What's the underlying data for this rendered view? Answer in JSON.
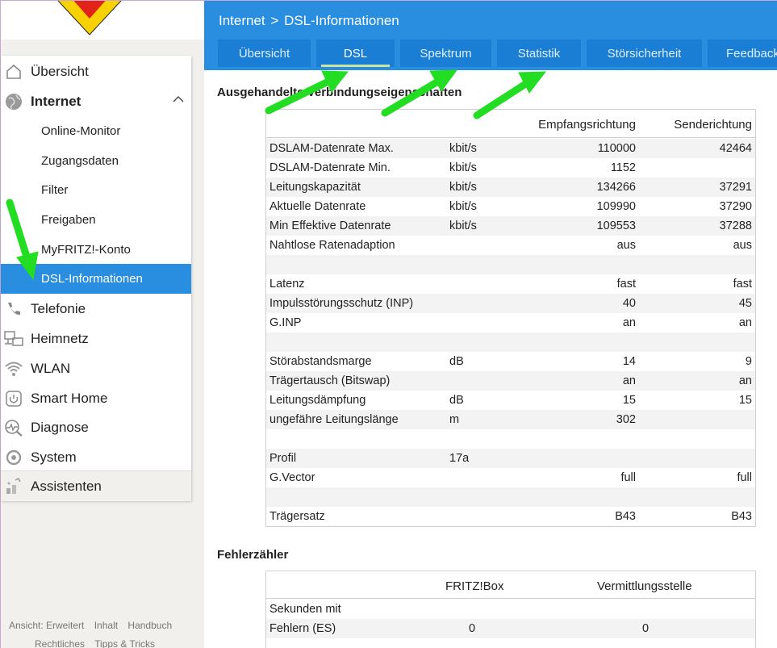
{
  "header": {
    "breadcrumb_root": "Internet",
    "breadcrumb_sep": ">",
    "breadcrumb_current": "DSL-Informationen",
    "tabs": [
      {
        "label": "Übersicht"
      },
      {
        "label": "DSL"
      },
      {
        "label": "Spektrum"
      },
      {
        "label": "Statistik"
      },
      {
        "label": "Störsicherheit"
      },
      {
        "label": "Feedback"
      }
    ]
  },
  "sidebar": {
    "items": [
      {
        "label": "Übersicht",
        "icon": "home-icon"
      },
      {
        "label": "Internet",
        "icon": "globe-icon"
      },
      {
        "label": "Online-Monitor"
      },
      {
        "label": "Zugangsdaten"
      },
      {
        "label": "Filter"
      },
      {
        "label": "Freigaben"
      },
      {
        "label": "MyFRITZ!-Konto"
      },
      {
        "label": "DSL-Informationen"
      },
      {
        "label": "Telefonie",
        "icon": "phone-icon"
      },
      {
        "label": "Heimnetz",
        "icon": "network-icon"
      },
      {
        "label": "WLAN",
        "icon": "wifi-icon"
      },
      {
        "label": "Smart Home",
        "icon": "smart-home-icon"
      },
      {
        "label": "Diagnose",
        "icon": "diagnose-icon"
      },
      {
        "label": "System",
        "icon": "system-icon"
      },
      {
        "label": "Assistenten",
        "icon": "wizard-icon"
      }
    ]
  },
  "footer": {
    "links": [
      "Ansicht: Erweitert",
      "Inhalt",
      "Handbuch",
      "Rechtliches",
      "Tipps & Tricks"
    ]
  },
  "section1": {
    "title": "Ausgehandelte Verbindungseigenschaften",
    "col_recv": "Empfangsrichtung",
    "col_send": "Senderichtung",
    "rows": [
      {
        "label": "DSLAM-Datenrate Max.",
        "unit": "kbit/s",
        "recv": "110000",
        "send": "42464"
      },
      {
        "label": "DSLAM-Datenrate Min.",
        "unit": "kbit/s",
        "recv": "1152",
        "send": ""
      },
      {
        "label": "Leitungskapazität",
        "unit": "kbit/s",
        "recv": "134266",
        "send": "37291"
      },
      {
        "label": "Aktuelle Datenrate",
        "unit": "kbit/s",
        "recv": "109990",
        "send": "37290"
      },
      {
        "label": "Min Effektive Datenrate",
        "unit": "kbit/s",
        "recv": "109553",
        "send": "37288"
      },
      {
        "label": "Nahtlose Ratenadaption",
        "unit": "",
        "recv": "aus",
        "send": "aus"
      },
      {
        "label": "",
        "unit": "",
        "recv": "",
        "send": ""
      },
      {
        "label": "Latenz",
        "unit": "",
        "recv": "fast",
        "send": "fast"
      },
      {
        "label": "Impulsstörungsschutz (INP)",
        "unit": "",
        "recv": "40",
        "send": "45"
      },
      {
        "label": "G.INP",
        "unit": "",
        "recv": "an",
        "send": "an"
      },
      {
        "label": "",
        "unit": "",
        "recv": "",
        "send": ""
      },
      {
        "label": "Störabstandsmarge",
        "unit": "dB",
        "recv": "14",
        "send": "9"
      },
      {
        "label": "Trägertausch (Bitswap)",
        "unit": "",
        "recv": "an",
        "send": "an"
      },
      {
        "label": "Leitungsdämpfung",
        "unit": "dB",
        "recv": "15",
        "send": "15"
      },
      {
        "label": "ungefähre Leitungslänge",
        "unit": "m",
        "recv": "302",
        "send": ""
      },
      {
        "label": "",
        "unit": "",
        "recv": "",
        "send": ""
      },
      {
        "label": "Profil",
        "unit": "17a",
        "recv": "",
        "send": ""
      },
      {
        "label": "G.Vector",
        "unit": "",
        "recv": "full",
        "send": "full"
      },
      {
        "label": "",
        "unit": "",
        "recv": "",
        "send": ""
      },
      {
        "label": "Trägersatz",
        "unit": "",
        "recv": "B43",
        "send": "B43"
      }
    ]
  },
  "section2": {
    "title": "Fehlerzähler",
    "col_box": "FRITZ!Box",
    "col_vst": "Vermittlungsstelle",
    "rows": [
      {
        "label": "Sekunden mit",
        "box": "",
        "vst": ""
      },
      {
        "label": "Fehlern (ES)",
        "box": "0",
        "vst": "0"
      }
    ]
  },
  "colors": {
    "accent": "#2a8ee0",
    "tab_bg": "#1a7fd4",
    "arrow": "#22dd22"
  }
}
